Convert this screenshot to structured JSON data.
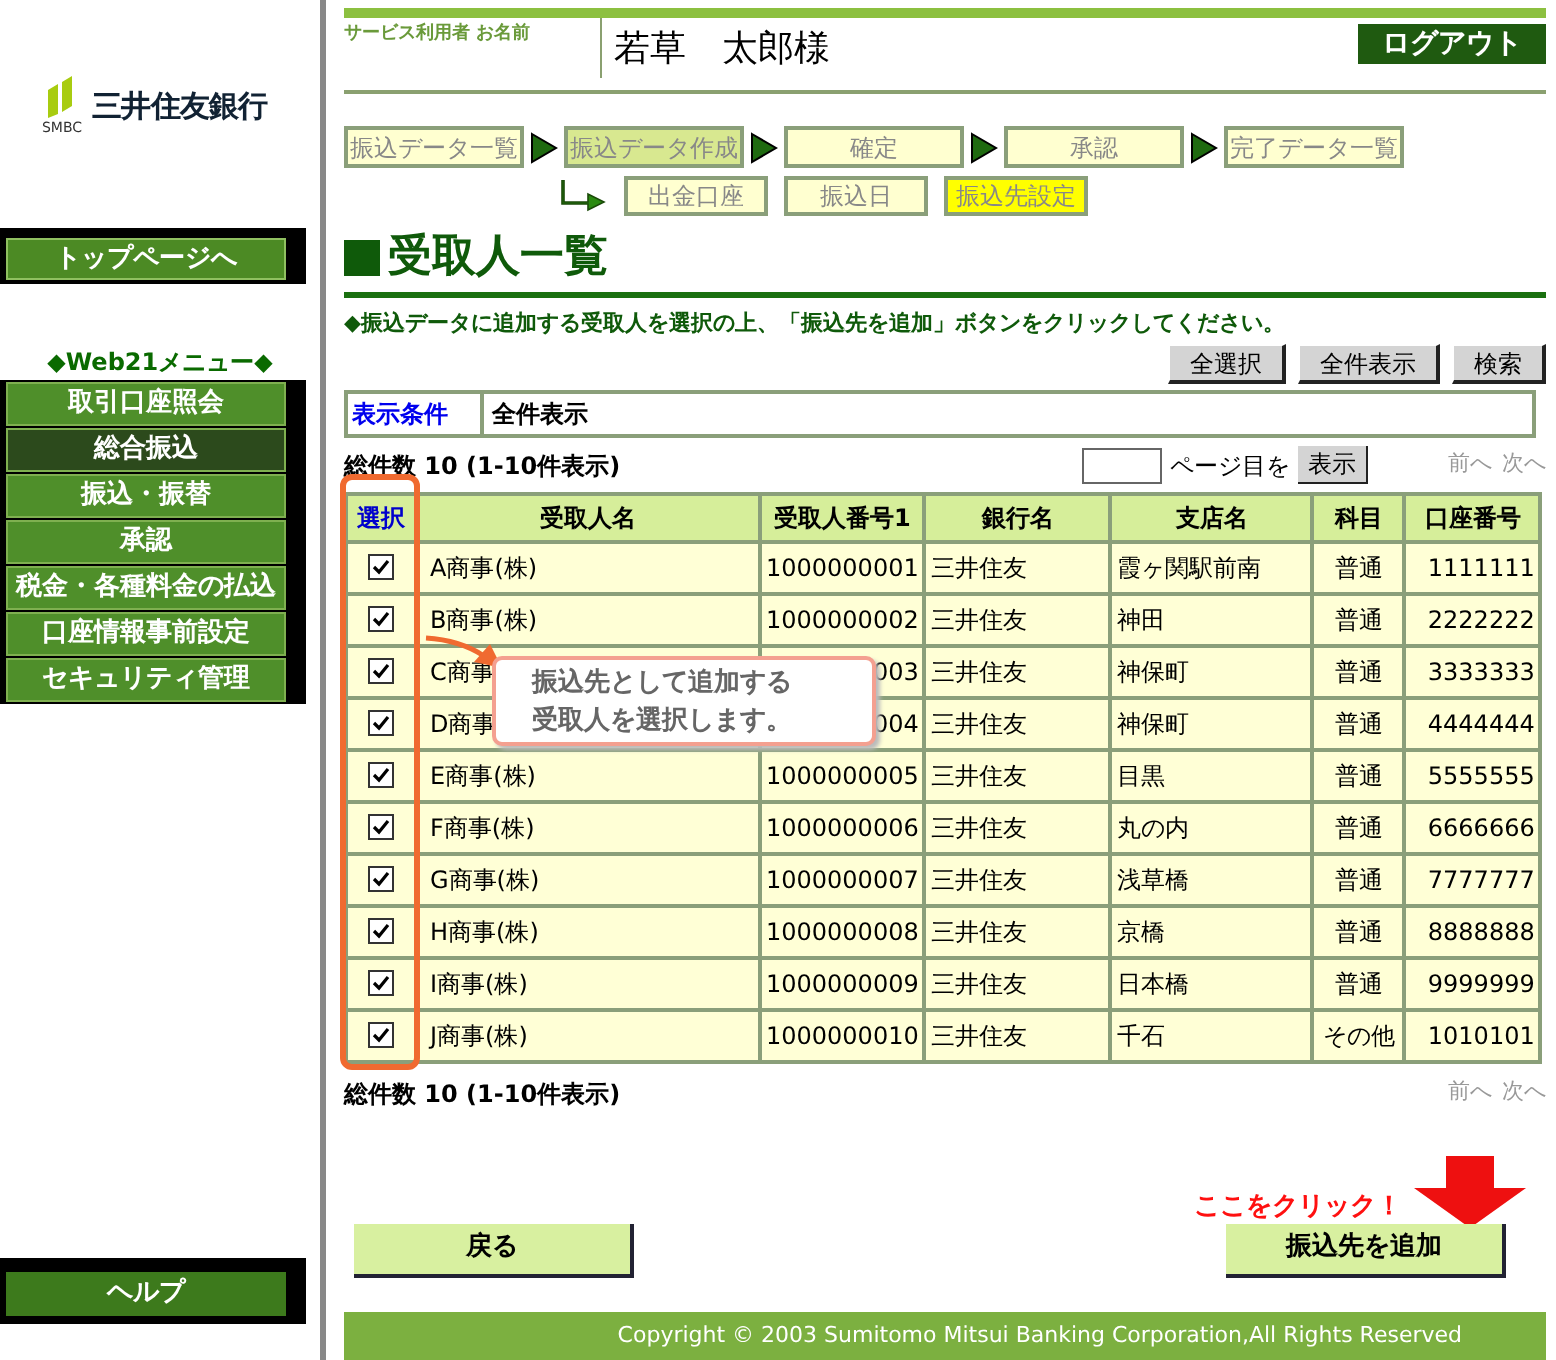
{
  "sidebar": {
    "bank_name": "三井住友銀行",
    "logo_sub": "SMBC",
    "top_button": "トップページへ",
    "menu_title": "◆Web21メニュー◆",
    "menu_items": [
      {
        "label": "取引口座照会",
        "selected": false
      },
      {
        "label": "総合振込",
        "selected": true
      },
      {
        "label": "振込・振替",
        "selected": false
      },
      {
        "label": "承認",
        "selected": false
      },
      {
        "label": "税金・各種料金の払込",
        "selected": false
      },
      {
        "label": "口座情報事前設定",
        "selected": false
      },
      {
        "label": "セキュリティ管理",
        "selected": false
      }
    ],
    "help_button": "ヘルプ"
  },
  "header": {
    "user_label": "サービス利用者 お名前",
    "user_name": "若草　太郎様",
    "logout": "ログアウト"
  },
  "steps": [
    {
      "label": "振込データ一覧",
      "selected": false
    },
    {
      "label": "振込データ作成",
      "selected": true
    },
    {
      "label": "確定",
      "selected": false
    },
    {
      "label": "承認",
      "selected": false
    },
    {
      "label": "完了データ一覧",
      "selected": false
    }
  ],
  "substeps": [
    {
      "label": "出金口座",
      "selected": false
    },
    {
      "label": "振込日",
      "selected": false
    },
    {
      "label": "振込先設定",
      "selected": true
    }
  ],
  "page_title": "受取人一覧",
  "instruction": "◆振込データに追加する受取人を選択の上、「振込先を追加」ボタンをクリックしてください。",
  "toolbar_buttons": [
    "全選択",
    "全件表示",
    "検索"
  ],
  "filter": {
    "label": "表示条件",
    "value": "全件表示"
  },
  "count_top": "総件数 10 (1-10件表示)",
  "page_jump": {
    "suffix": "ページ目を",
    "button": "表示"
  },
  "pager_top": [
    "前へ",
    "次へ"
  ],
  "table": {
    "select_header": "選択",
    "columns": [
      "受取人名",
      "受取人番号1",
      "銀行名",
      "支店名",
      "科目",
      "口座番号"
    ],
    "rows": [
      {
        "checked": true,
        "cells": [
          "A商事(株)",
          "1000000001",
          "三井住友",
          "霞ヶ関駅前南",
          "普通",
          "1111111"
        ]
      },
      {
        "checked": true,
        "cells": [
          "B商事(株)",
          "1000000002",
          "三井住友",
          "神田",
          "普通",
          "2222222"
        ]
      },
      {
        "checked": true,
        "cells": [
          "C商事",
          "003",
          "三井住友",
          "神保町",
          "普通",
          "3333333"
        ]
      },
      {
        "checked": true,
        "cells": [
          "D商事",
          "004",
          "三井住友",
          "神保町",
          "普通",
          "4444444"
        ]
      },
      {
        "checked": true,
        "cells": [
          "E商事(株)",
          "1000000005",
          "三井住友",
          "目黒",
          "普通",
          "5555555"
        ]
      },
      {
        "checked": true,
        "cells": [
          "F商事(株)",
          "1000000006",
          "三井住友",
          "丸の内",
          "普通",
          "6666666"
        ]
      },
      {
        "checked": true,
        "cells": [
          "G商事(株)",
          "1000000007",
          "三井住友",
          "浅草橋",
          "普通",
          "7777777"
        ]
      },
      {
        "checked": true,
        "cells": [
          "H商事(株)",
          "1000000008",
          "三井住友",
          "京橋",
          "普通",
          "8888888"
        ]
      },
      {
        "checked": true,
        "cells": [
          "I商事(株)",
          "1000000009",
          "三井住友",
          "日本橋",
          "普通",
          "9999999"
        ]
      },
      {
        "checked": true,
        "cells": [
          "J商事(株)",
          "1000000010",
          "三井住友",
          "千石",
          "その他",
          "1010101"
        ]
      }
    ]
  },
  "callout": [
    "振込先として追加する",
    "受取人を選択します。"
  ],
  "count_bottom": "総件数 10 (1-10件表示)",
  "pager_bottom": [
    "前へ",
    "次へ"
  ],
  "click_hint": "ここをクリック！",
  "back_button": "戻る",
  "add_button": "振込先を追加",
  "footer": "Copyright © 2003 Sumitomo Mitsui Banking Corporation,All Rights Reserved"
}
